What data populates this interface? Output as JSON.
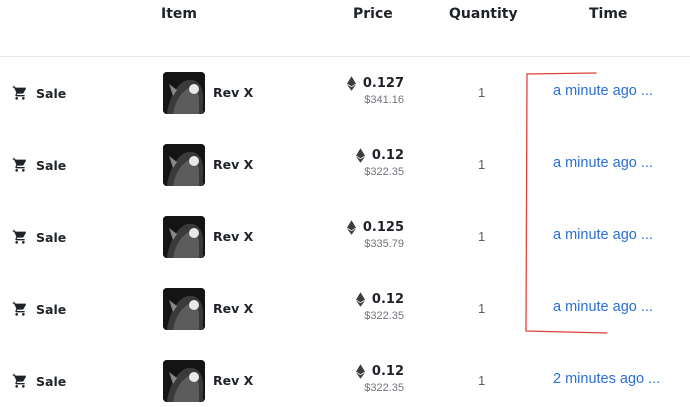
{
  "header": {
    "item": "Item",
    "price": "Price",
    "quantity": "Quantity",
    "time": "Time"
  },
  "rows": [
    {
      "event": "Sale",
      "item_name": "Rev X",
      "price_eth": "0.127",
      "price_usd": "$341.16",
      "quantity": "1",
      "time": "a minute ago ..."
    },
    {
      "event": "Sale",
      "item_name": "Rev X",
      "price_eth": "0.12",
      "price_usd": "$322.35",
      "quantity": "1",
      "time": "a minute ago ..."
    },
    {
      "event": "Sale",
      "item_name": "Rev X",
      "price_eth": "0.125",
      "price_usd": "$335.79",
      "quantity": "1",
      "time": "a minute ago ..."
    },
    {
      "event": "Sale",
      "item_name": "Rev X",
      "price_eth": "0.12",
      "price_usd": "$322.35",
      "quantity": "1",
      "time": "a minute ago ..."
    },
    {
      "event": "Sale",
      "item_name": "Rev X",
      "price_eth": "0.12",
      "price_usd": "$322.35",
      "quantity": "1",
      "time": "2 minutes ago ..."
    }
  ],
  "icons": {
    "event": "shopping-cart-icon",
    "currency": "ethereum-icon"
  },
  "colors": {
    "time_link": "#2a6fd1",
    "annotation": "#e0403a"
  }
}
